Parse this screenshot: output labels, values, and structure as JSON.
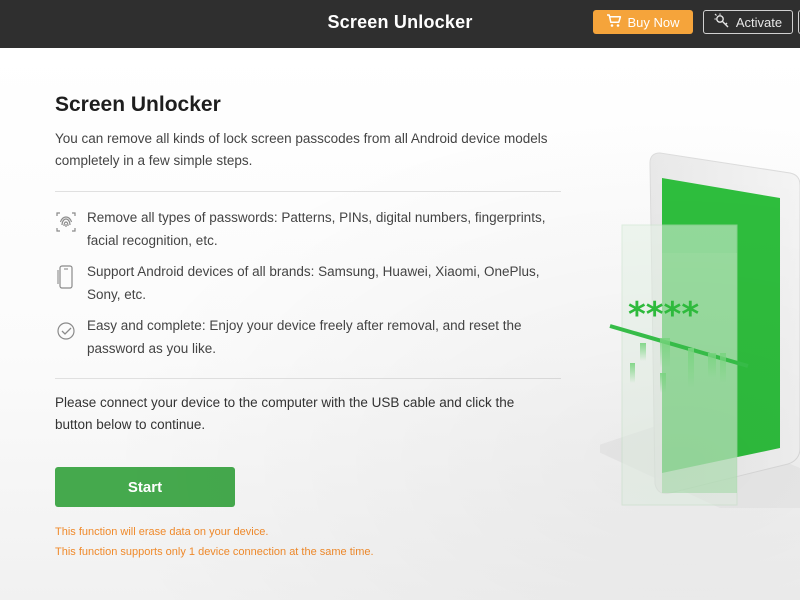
{
  "header": {
    "title": "Screen Unlocker",
    "buy_label": "Buy Now",
    "activate_label": "Activate"
  },
  "main": {
    "title": "Screen Unlocker",
    "description": "You can remove all kinds of lock screen passcodes from all Android device models completely in a few simple steps.",
    "features": [
      {
        "icon": "fingerprint-icon",
        "text": "Remove all types of passwords: Patterns, PINs, digital numbers, fingerprints, facial recognition, etc."
      },
      {
        "icon": "phone-icon",
        "text": "Support Android devices of all brands: Samsung, Huawei, Xiaomi, OnePlus, Sony, etc."
      },
      {
        "icon": "check-circle-icon",
        "text": "Easy and complete: Enjoy your device freely after removal, and reset the password as you like."
      }
    ],
    "connect_text": "Please connect your device to the computer with the USB cable and click the button below to continue.",
    "start_label": "Start",
    "warnings": [
      "This function will erase data on your device.",
      "This function supports only 1 device connection at the same time."
    ]
  },
  "illustration": {
    "password_text": "****"
  },
  "colors": {
    "topbar": "#2f2f2f",
    "buy": "#f5a43b",
    "start": "#45a94d",
    "warning": "#f08a2b",
    "screen_green": "#2fbf3e"
  }
}
